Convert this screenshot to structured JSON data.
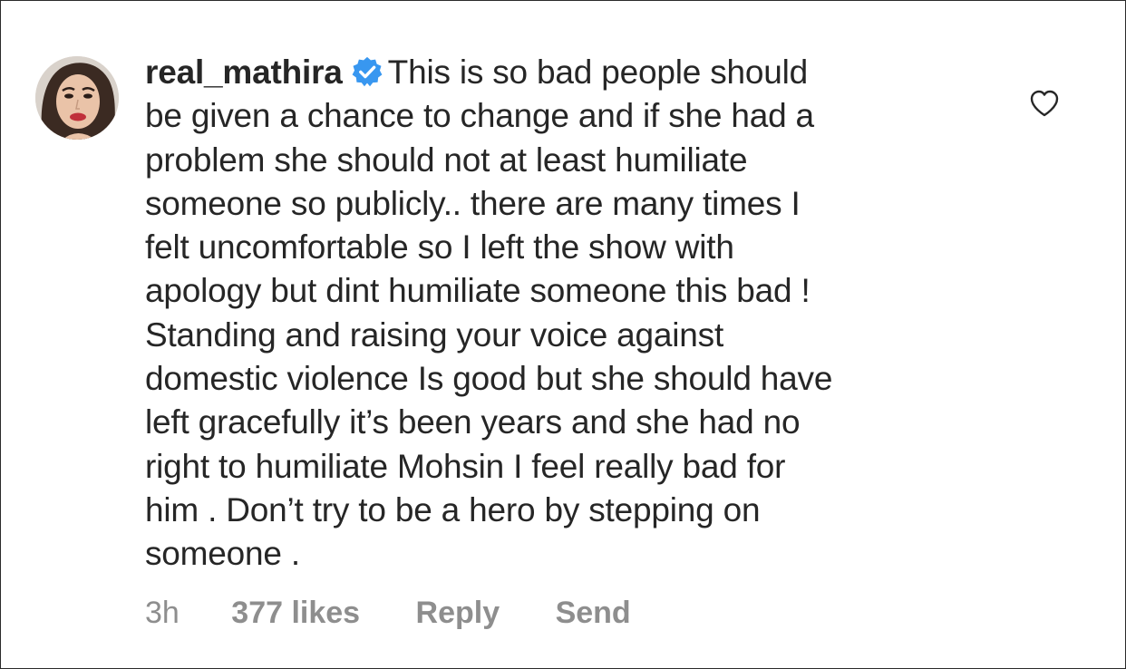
{
  "comment": {
    "username": "real_mathira",
    "verified": true,
    "lines": [
      "This is so bad people should",
      "be given a chance to change and if she had a",
      "problem she should not at least humiliate",
      "someone so publicly.. there are many times I",
      "felt uncomfortable so I left the show with",
      "apology but dint humiliate someone this bad !",
      "Standing and raising your voice against",
      "domestic violence Is good but she should have",
      "left gracefully it’s been years and she had no",
      "right to humiliate Mohsin I feel really bad for",
      "him . Don’t try to be a hero by stepping on",
      "someone ."
    ]
  },
  "meta": {
    "time": "3h",
    "likes": "377 likes",
    "reply_label": "Reply",
    "send_label": "Send"
  },
  "icons": {
    "verified_badge": "verified-badge-icon",
    "like": "heart-outline-icon"
  },
  "colors": {
    "text": "#262626",
    "secondary": "#8e8e8e",
    "verified": "#3897f0"
  }
}
